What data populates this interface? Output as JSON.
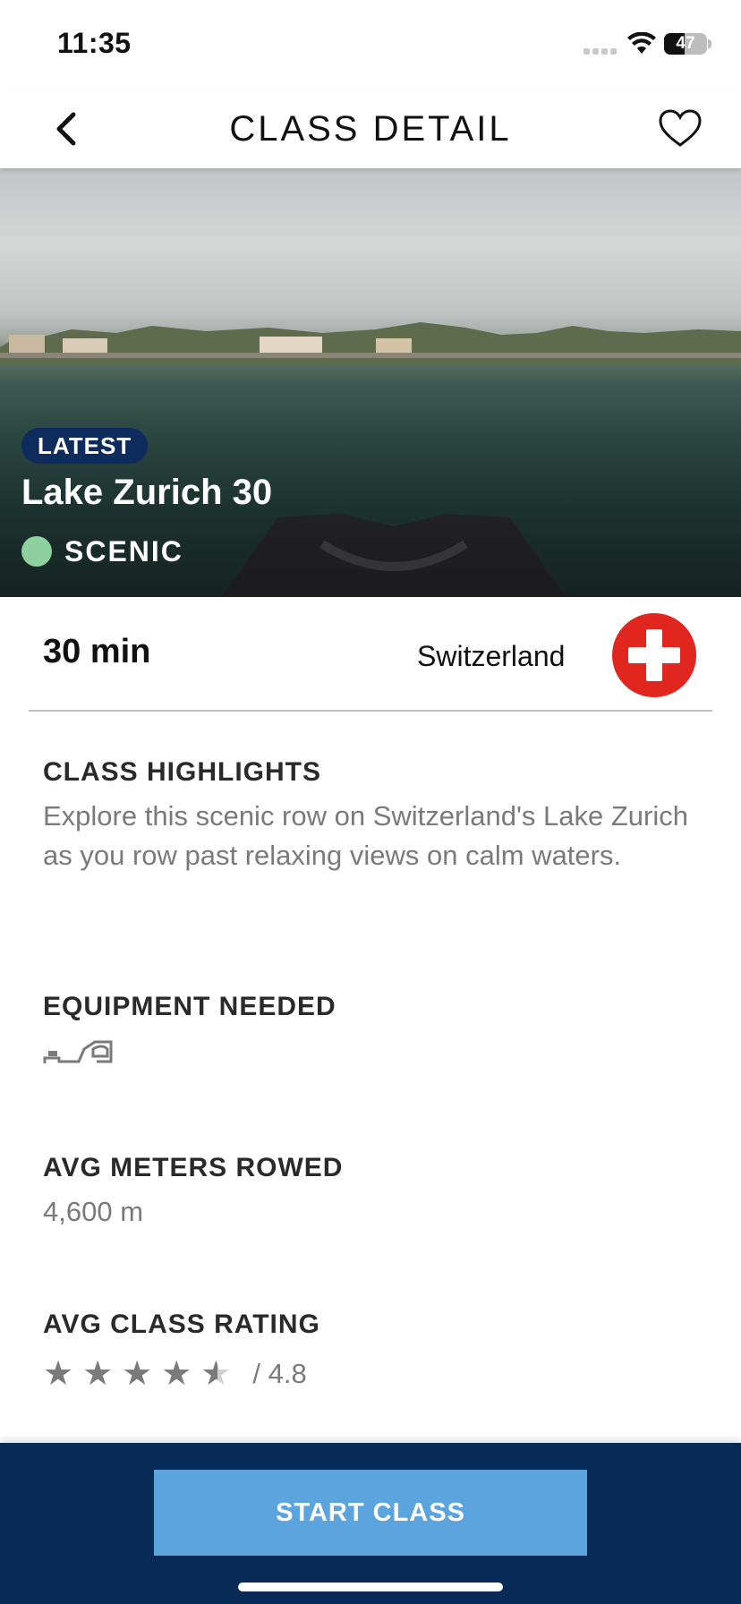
{
  "status_bar": {
    "time": "11:35",
    "battery_level": "47",
    "battery_fraction": 0.47,
    "icons": [
      "signal-icon",
      "wifi-icon",
      "battery-icon"
    ]
  },
  "header": {
    "title": "CLASS DETAIL",
    "back_icon": "chevron-left-icon",
    "favorite_icon": "heart-outline-icon"
  },
  "hero": {
    "badge": "LATEST",
    "class_name": "Lake Zurich 30",
    "category": "SCENIC",
    "category_color": "#8fd19e",
    "badge_color": "#0d2b5c"
  },
  "info": {
    "duration": "30 min",
    "country": "Switzerland",
    "flag_icon": "swiss-flag-icon",
    "flag_color": "#e0261f"
  },
  "highlights": {
    "title": "CLASS HIGHLIGHTS",
    "text": "Explore this scenic row on Switzerland's Lake Zurich as you row past relaxing views on calm waters."
  },
  "equipment": {
    "title": "EQUIPMENT NEEDED",
    "icon": "rowing-machine-icon"
  },
  "meters": {
    "title": "AVG METERS ROWED",
    "value": "4,600 m"
  },
  "rating": {
    "title": "AVG CLASS RATING",
    "value_label": "/ 4.8",
    "stars_out_of_5": 4.8
  },
  "bottom": {
    "start_label": "START CLASS",
    "bar_color": "#072a57",
    "button_color": "#5ba4de"
  }
}
